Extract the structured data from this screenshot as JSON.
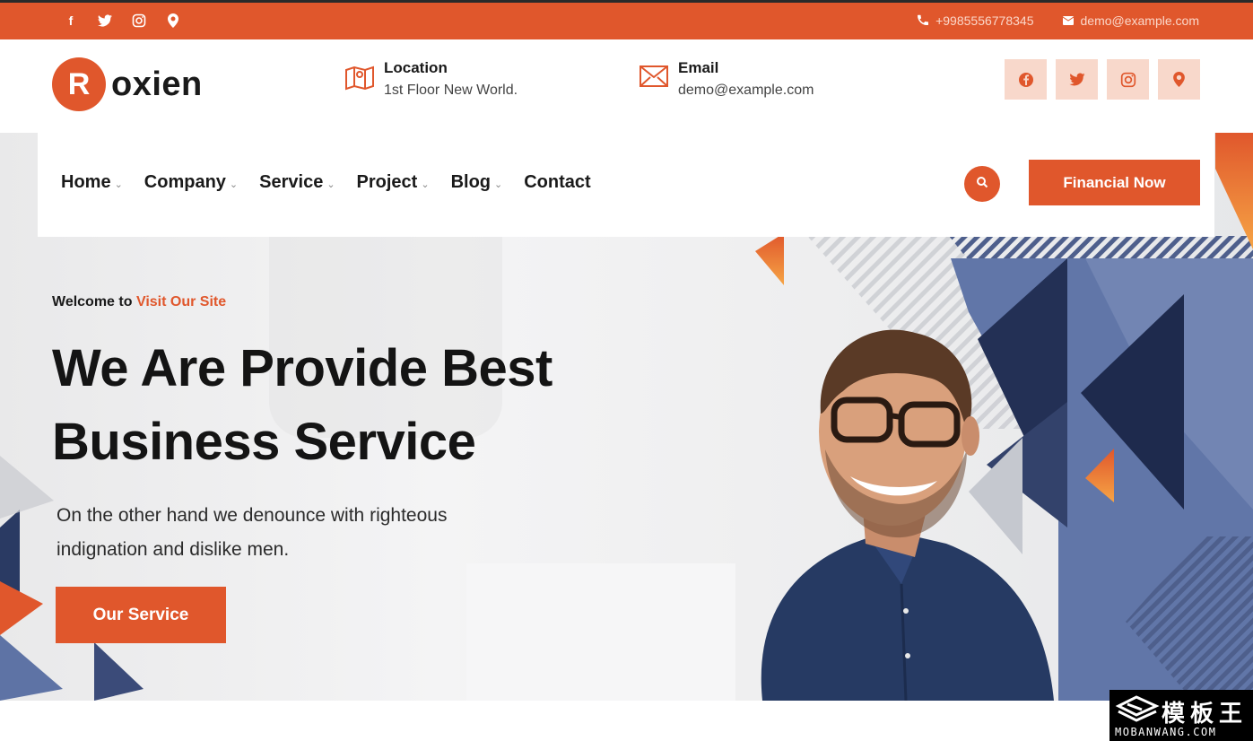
{
  "topbar": {
    "social_icons": [
      "facebook-icon",
      "twitter-icon",
      "instagram-icon",
      "map-pin-icon"
    ],
    "phone": "+9985556778345",
    "email": "demo@example.com"
  },
  "header": {
    "logo_letter": "R",
    "logo_word": "oxien",
    "location_label": "Location",
    "location_value": "1st Floor New World.",
    "email_label": "Email",
    "email_value": "demo@example.com",
    "social_icons": [
      "facebook-icon",
      "twitter-icon",
      "instagram-icon",
      "map-pin-icon"
    ]
  },
  "nav": {
    "items": [
      {
        "label": "Home",
        "has_dropdown": true
      },
      {
        "label": "Company",
        "has_dropdown": true
      },
      {
        "label": "Service",
        "has_dropdown": true
      },
      {
        "label": "Project",
        "has_dropdown": true
      },
      {
        "label": "Blog",
        "has_dropdown": true
      },
      {
        "label": "Contact",
        "has_dropdown": false
      }
    ],
    "cta": "Financial Now"
  },
  "hero": {
    "welcome_prefix": "Welcome to",
    "welcome_highlight": "Visit Our Site",
    "headline_line1": "We Are Provide Best",
    "headline_line2": "Business Service",
    "subtext_line1": "On the other hand we denounce with righteous",
    "subtext_line2": "indignation and dislike men.",
    "button": "Our Service"
  },
  "watermark": {
    "cn": "模板王",
    "en": "MOBANWANG.COM"
  },
  "colors": {
    "accent": "#e0572c",
    "accent_light": "#f8d8cb",
    "navy": "#2f3f6b",
    "slate": "#5f74a7"
  }
}
